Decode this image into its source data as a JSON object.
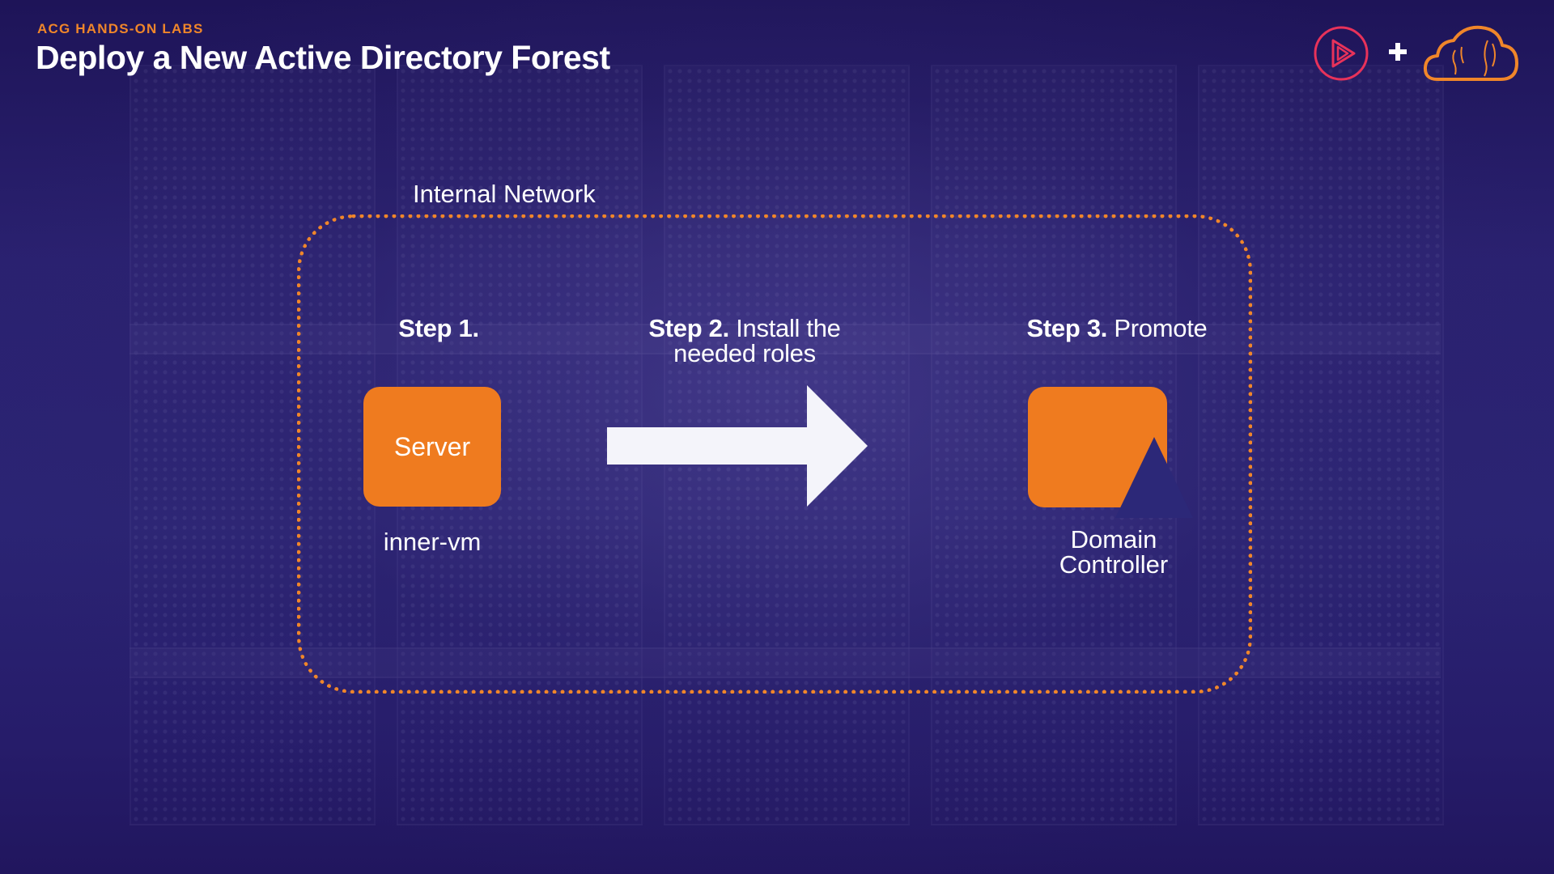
{
  "header": {
    "eyebrow": "ACG HANDS-ON LABS",
    "title": "Deploy a New Active Directory Forest"
  },
  "logos": {
    "left": "play-logo-icon",
    "separator": "+",
    "right": "cloud-logo-icon"
  },
  "diagram": {
    "network_label": "Internal Network",
    "steps": [
      {
        "number": "Step 1.",
        "text": ""
      },
      {
        "number": "Step 2.",
        "text": "Install the",
        "text_line2": "needed roles"
      },
      {
        "number": "Step 3.",
        "text": "Promote"
      }
    ],
    "server": {
      "label": "Server",
      "caption": "inner-vm"
    },
    "domain_controller": {
      "caption_line1": "Domain",
      "caption_line2": "Controller"
    }
  },
  "colors": {
    "accent": "#ef7b1f",
    "background": "#2a2170",
    "triangle": "#2c2878",
    "arrow": "#f4f4fa"
  }
}
